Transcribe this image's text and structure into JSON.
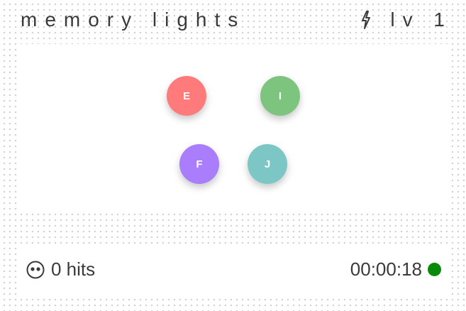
{
  "header": {
    "title": "memory lights",
    "level_icon": "lightning-bolt-icon",
    "level_label": "lv 1"
  },
  "board": {
    "lights": [
      {
        "key": "E",
        "color": "#ff7b7b"
      },
      {
        "key": "I",
        "color": "#7dc47f"
      },
      {
        "key": "F",
        "color": "#a97dfb"
      },
      {
        "key": "J",
        "color": "#7cc6c6"
      }
    ]
  },
  "footer": {
    "hits_icon": "face-icon",
    "hits_label": "0 hits",
    "timer": "00:00:18",
    "status_color": "#0a8a0a"
  }
}
